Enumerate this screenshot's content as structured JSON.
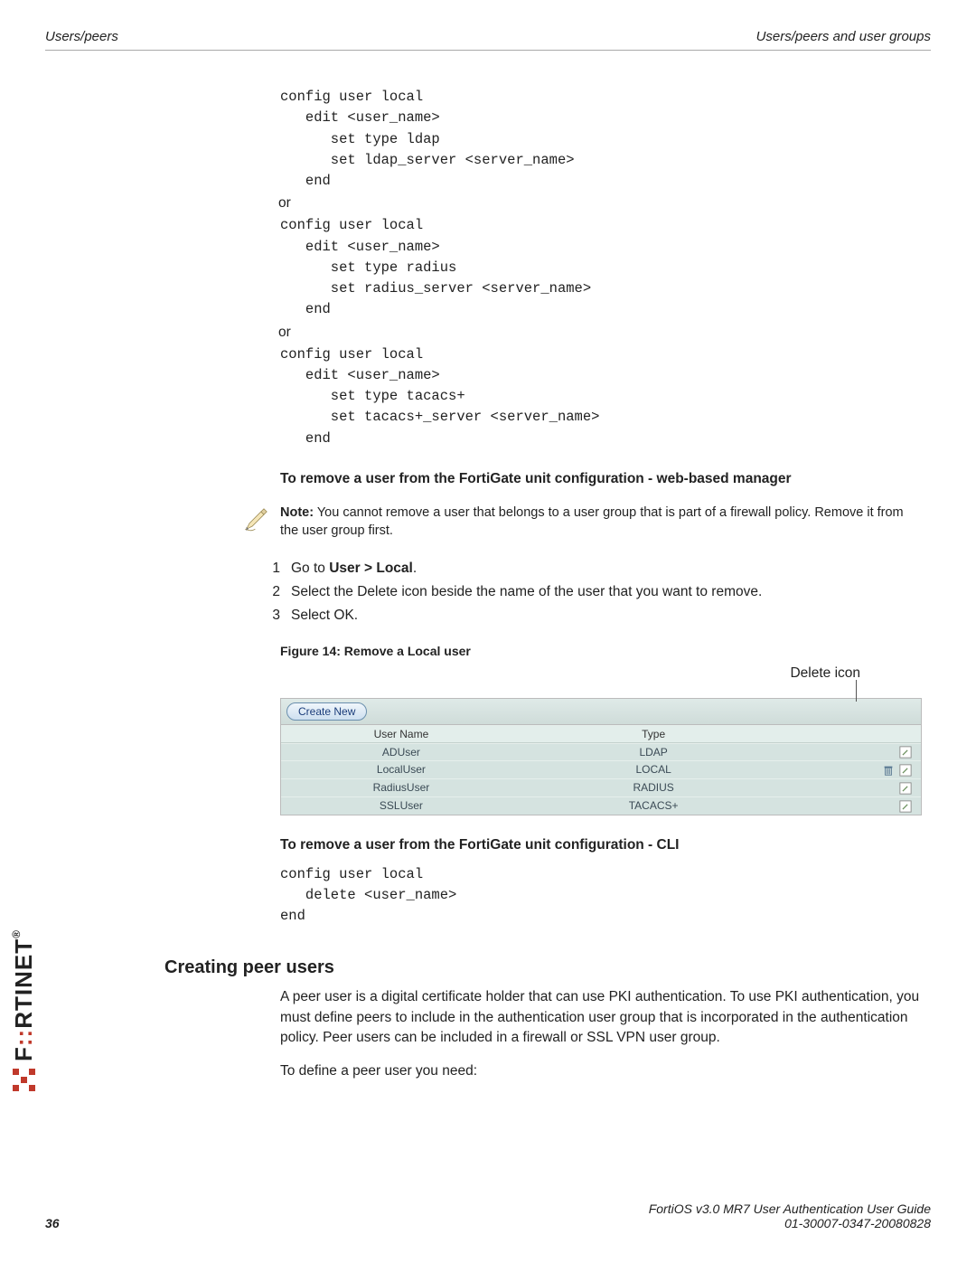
{
  "header": {
    "left": "Users/peers",
    "right": "Users/peers and user groups"
  },
  "code1": "config user local\n   edit <user_name>\n      set type ldap\n      set ldap_server <server_name>\n   end",
  "or": "or",
  "code2": "config user local\n   edit <user_name>\n      set type radius\n      set radius_server <server_name>\n   end",
  "code3": "config user local\n   edit <user_name>\n      set type tacacs+\n      set tacacs+_server <server_name>\n   end",
  "h_remove_web": "To remove a user from the FortiGate unit configuration - web-based manager",
  "note_label": "Note:",
  "note_text": " You cannot remove a user that belongs to a user group that is part of a firewall policy. Remove it from the user group first.",
  "steps": {
    "s1_pre": "Go to ",
    "s1_bold": "User > Local",
    "s1_post": ".",
    "s2": "Select the Delete icon beside the name of the user that you want to remove.",
    "s3": "Select OK."
  },
  "figcap": "Figure 14: Remove a Local user",
  "delete_label": "Delete icon",
  "ui": {
    "create": "Create New",
    "col1": "User Name",
    "col2": "Type",
    "rows": [
      {
        "name": "ADUser",
        "type": "LDAP",
        "del": false,
        "edit": true
      },
      {
        "name": "LocalUser",
        "type": "LOCAL",
        "del": true,
        "edit": true
      },
      {
        "name": "RadiusUser",
        "type": "RADIUS",
        "del": false,
        "edit": true
      },
      {
        "name": "SSLUser",
        "type": "TACACS+",
        "del": false,
        "edit": true
      }
    ]
  },
  "h_remove_cli": "To remove a user from the FortiGate unit configuration - CLI",
  "code4": "config user local\n   delete <user_name>\nend",
  "sect": "Creating peer users",
  "para1": "A peer user is a digital certificate holder that can use PKI authentication. To use PKI authentication, you must define peers to include in the authentication user group that is incorporated in the authentication policy. Peer users can be included in a firewall or SSL VPN user group.",
  "para2": "To define a peer user you need:",
  "footer": {
    "page": "36",
    "line1": "FortiOS v3.0 MR7 User Authentication User Guide",
    "line2": "01-30007-0347-20080828"
  },
  "logo": "RTINET"
}
